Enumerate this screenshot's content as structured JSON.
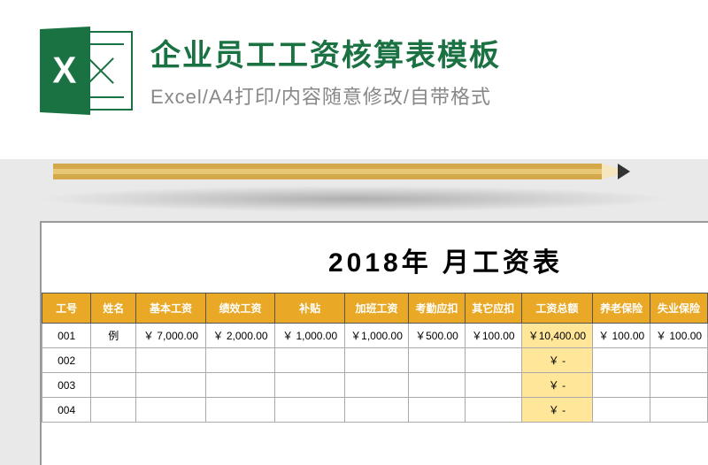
{
  "header": {
    "icon_letter": "X",
    "title": "企业员工工资核算表模板",
    "subtitle": "Excel/A4打印/内容随意修改/自带格式"
  },
  "spreadsheet": {
    "title": "2018年  月工资表",
    "columns": {
      "id": "工号",
      "name": "姓名",
      "base": "基本工资",
      "perf": "绩效工资",
      "sub": "补贴",
      "ot": "加班工资",
      "att": "考勤应扣",
      "other": "其它应扣",
      "total": "工资总额",
      "pension": "养老保险",
      "unemp": "失业保险"
    },
    "rows": [
      {
        "id": "001",
        "name": "例",
        "base": "￥ 7,000.00",
        "perf": "￥ 2,000.00",
        "sub": "￥ 1,000.00",
        "ot": "￥1,000.00",
        "att": "￥500.00",
        "other": "￥100.00",
        "total": "￥10,400.00",
        "pension": "￥ 100.00",
        "unemp": "￥ 100.00"
      },
      {
        "id": "002",
        "name": "",
        "base": "",
        "perf": "",
        "sub": "",
        "ot": "",
        "att": "",
        "other": "",
        "total": "￥        -",
        "pension": "",
        "unemp": ""
      },
      {
        "id": "003",
        "name": "",
        "base": "",
        "perf": "",
        "sub": "",
        "ot": "",
        "att": "",
        "other": "",
        "total": "￥        -",
        "pension": "",
        "unemp": ""
      },
      {
        "id": "004",
        "name": "",
        "base": "",
        "perf": "",
        "sub": "",
        "ot": "",
        "att": "",
        "other": "",
        "total": "￥        -",
        "pension": "",
        "unemp": ""
      }
    ]
  }
}
